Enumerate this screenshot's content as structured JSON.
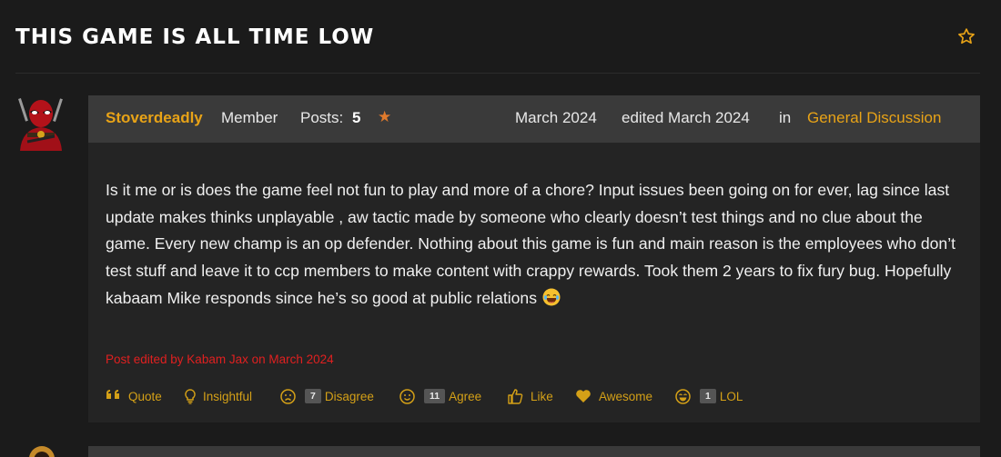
{
  "thread": {
    "title": "THIS GAME IS ALL TIME LOW",
    "bookmark_icon": "star-outline-icon"
  },
  "post": {
    "author": {
      "username": "Stoverdeadly",
      "role": "Member",
      "posts_label": "Posts:",
      "posts_count": "5",
      "rank_icon": "star-icon"
    },
    "date": "March 2024",
    "edited": "edited March 2024",
    "in_label": "in",
    "category": "General Discussion",
    "body": "Is it me or is does the game feel not fun to play and more of a chore? Input issues been going on for ever, lag since last update makes thinks unplayable , aw tactic made by someone who clearly doesn’t test things and no clue about the game. Every new champ is an op defender. Nothing about this game is fun and main reason is the employees who don’t test stuff and leave it to ccp members to make content with crappy rewards. Took them 2 years to fix fury bug. Hopefully kabaam Mike responds since he’s so good at public relations",
    "edit_note": "Post edited by Kabam Jax on March 2024",
    "reactions": [
      {
        "icon": "quote-icon",
        "label": "Quote",
        "count": ""
      },
      {
        "icon": "lightbulb-icon",
        "label": "Insightful",
        "count": ""
      },
      {
        "icon": "frown-icon",
        "label": "Disagree",
        "count": "7"
      },
      {
        "icon": "smile-icon",
        "label": "Agree",
        "count": "11"
      },
      {
        "icon": "thumbs-up-icon",
        "label": "Like",
        "count": ""
      },
      {
        "icon": "heart-icon",
        "label": "Awesome",
        "count": ""
      },
      {
        "icon": "laugh-icon",
        "label": "LOL",
        "count": "1"
      }
    ]
  },
  "colors": {
    "accent": "#e8a317",
    "edit_note": "#e02020",
    "background": "#1b1b1b",
    "post_header": "#3a3a3a",
    "post_body": "#242424"
  }
}
